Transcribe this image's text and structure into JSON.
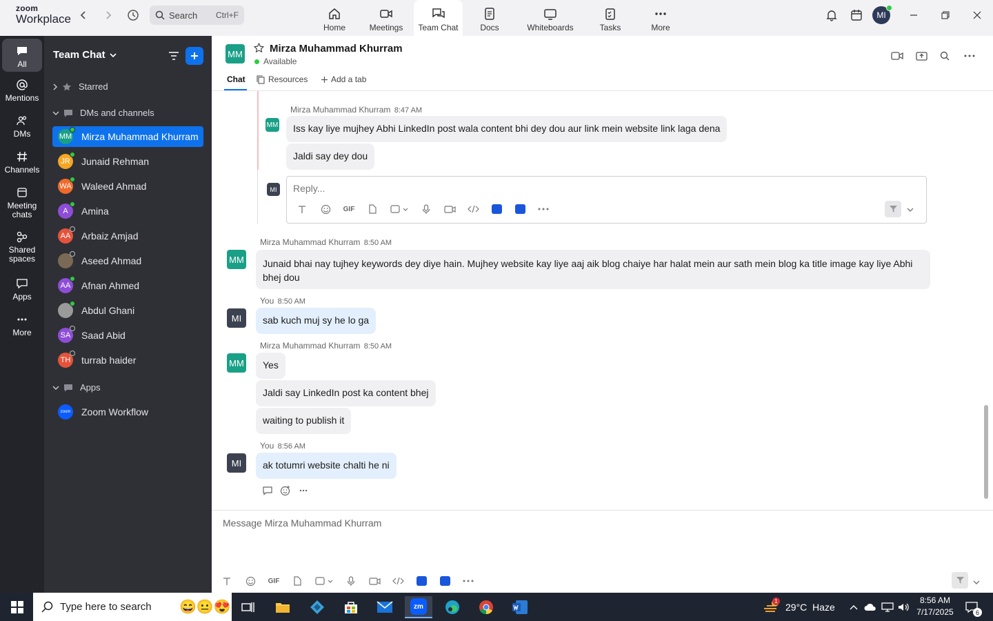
{
  "app": {
    "logo_top": "zoom",
    "logo_bottom": "Workplace"
  },
  "search": {
    "label": "Search",
    "shortcut": "Ctrl+F"
  },
  "top_tabs": [
    {
      "label": "Home"
    },
    {
      "label": "Meetings"
    },
    {
      "label": "Team Chat"
    },
    {
      "label": "Docs"
    },
    {
      "label": "Whiteboards"
    },
    {
      "label": "Tasks"
    },
    {
      "label": "More"
    }
  ],
  "user_avatar": "MI",
  "rail": [
    {
      "label": "All"
    },
    {
      "label": "Mentions"
    },
    {
      "label": "DMs"
    },
    {
      "label": "Channels"
    },
    {
      "label": "Meeting chats"
    },
    {
      "label": "Shared spaces"
    },
    {
      "label": "Apps"
    },
    {
      "label": "More"
    }
  ],
  "sidebar": {
    "title": "Team Chat",
    "starred": "Starred",
    "dms_section": "DMs and channels",
    "contacts": [
      {
        "initials": "MM",
        "name": "Mirza Muhammad Khurram",
        "color": "#1aa087"
      },
      {
        "initials": "JR",
        "name": "Junaid Rehman",
        "color": "#f5a623"
      },
      {
        "initials": "WA",
        "name": "Waleed Ahmad",
        "color": "#f06a2b"
      },
      {
        "initials": "A",
        "name": "Amina",
        "color": "#8e4dd6"
      },
      {
        "initials": "AA",
        "name": "Arbaiz Amjad",
        "color": "#e5533b"
      },
      {
        "initials": "",
        "name": "Aseed Ahmad",
        "color": "#7a6a55"
      },
      {
        "initials": "AA",
        "name": "Afnan Ahmed",
        "color": "#8e4dd6"
      },
      {
        "initials": "",
        "name": "Abdul Ghani",
        "color": "#9a9a9a"
      },
      {
        "initials": "SA",
        "name": "Saad Abid",
        "color": "#8e4dd6"
      },
      {
        "initials": "TH",
        "name": "turrab haider",
        "color": "#e5533b"
      }
    ],
    "apps_section": "Apps",
    "app_item": {
      "icon_text": "zoom",
      "name": "Zoom Workflow"
    }
  },
  "header": {
    "initials": "MM",
    "name": "Mirza Muhammad Khurram",
    "status": "Available",
    "tabs": [
      "Chat",
      "Resources",
      "Add a tab"
    ]
  },
  "messages": {
    "thread": {
      "sender": "Mirza Muhammad Khurram",
      "time": "8:47 AM",
      "initials": "MM",
      "lines": [
        "Iss kay liye mujhey Abhi LinkedIn post wala content bhi dey dou aur link mein website link laga dena",
        "Jaldi say dey dou"
      ],
      "reply_initials": "MI",
      "reply_placeholder": "Reply..."
    },
    "m1": {
      "sender": "Mirza Muhammad Khurram",
      "time": "8:50 AM",
      "initials": "MM",
      "text": "Junaid bhai nay tujhey keywords dey diye hain. Mujhey website kay liye aaj aik blog chaiye har halat mein aur sath mein blog ka title image kay liye Abhi bhej dou"
    },
    "m2": {
      "sender": "You",
      "time": "8:50 AM",
      "initials": "MI",
      "text": "sab kuch muj sy he lo ga"
    },
    "m3": {
      "sender": "Mirza Muhammad Khurram",
      "time": "8:50 AM",
      "initials": "MM",
      "lines": [
        "Yes",
        "Jaldi say LinkedIn post ka content bhej",
        "waiting to publish it"
      ]
    },
    "m4": {
      "sender": "You",
      "time": "8:56 AM",
      "initials": "MI",
      "text": "ak totumri website chalti he ni"
    }
  },
  "composer": {
    "placeholder": "Message Mirza Muhammad Khurram"
  },
  "toolbar": {
    "gif": "GIF"
  },
  "taskbar": {
    "search_placeholder": "Type here to search",
    "weather": "29°C  Haze",
    "weather_badge": "1",
    "time": "8:56 AM",
    "date": "7/17/2025",
    "notif_count": "6"
  }
}
